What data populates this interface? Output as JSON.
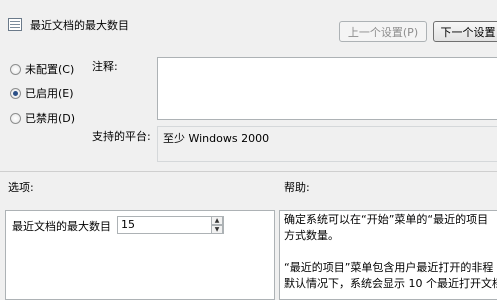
{
  "window": {
    "title": "最近文档的最大数目"
  },
  "nav": {
    "prev_label": "上一个设置(P)",
    "next_label": "下一个设置"
  },
  "state_options": [
    {
      "label": "未配置(C)",
      "checked": false
    },
    {
      "label": "已启用(E)",
      "checked": true
    },
    {
      "label": "已禁用(D)",
      "checked": false
    }
  ],
  "comment": {
    "label": "注释:",
    "value": ""
  },
  "supported": {
    "label": "支持的平台:",
    "value": "至少 Windows 2000"
  },
  "options": {
    "label": "选项:",
    "setting_label": "最近文档的最大数目",
    "setting_value": "15"
  },
  "help": {
    "label": "帮助:",
    "lines": [
      "确定系统可以在“开始”菜单的“最近的项目",
      "方式数量。",
      "",
      "“最近的项目”菜单包含用户最近打开的非程",
      "默认情况下，系统会显示 10 个最近打开文档"
    ]
  }
}
